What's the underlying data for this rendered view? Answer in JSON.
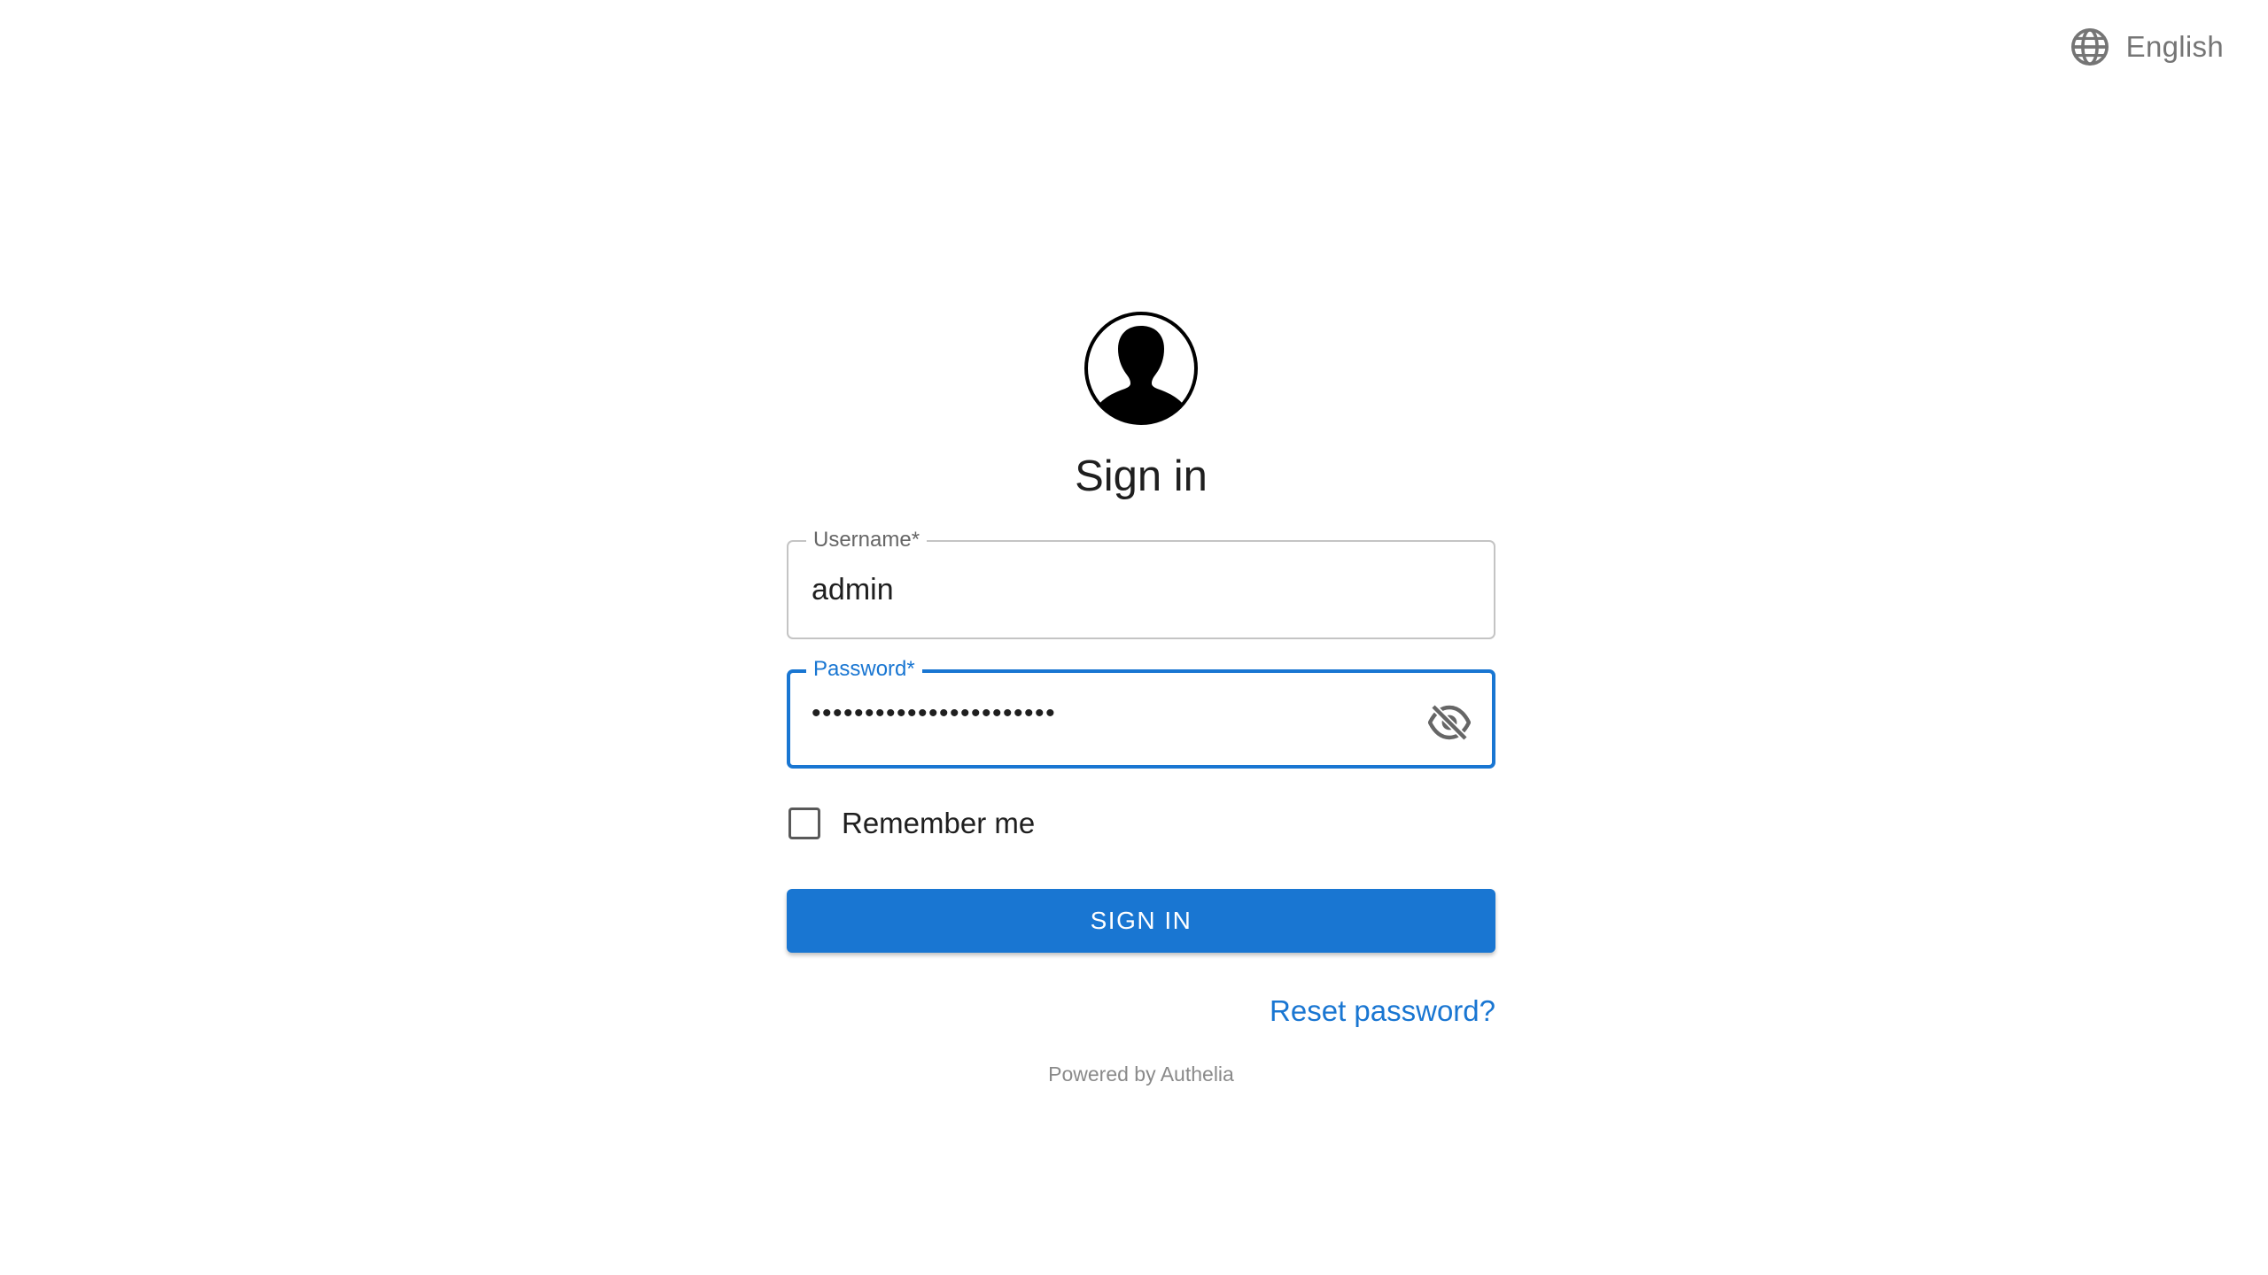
{
  "language": {
    "icon": "globe-icon",
    "label": "English"
  },
  "login": {
    "avatar_icon": "user-avatar-icon",
    "title": "Sign in",
    "username": {
      "label": "Username",
      "required_mark": "*",
      "value": "admin"
    },
    "password": {
      "label": "Password",
      "required_mark": "*",
      "masked_value": "•••••••••••••••••••••••",
      "toggle_icon": "eye-off-icon"
    },
    "remember_me": {
      "label": "Remember me",
      "checked": false
    },
    "submit_label": "SIGN IN",
    "reset_link": "Reset password?",
    "footer": "Powered by Authelia"
  },
  "colors": {
    "primary": "#1976d2",
    "text": "#1f1f1f",
    "muted": "#757575",
    "border": "#c4c4c4"
  }
}
